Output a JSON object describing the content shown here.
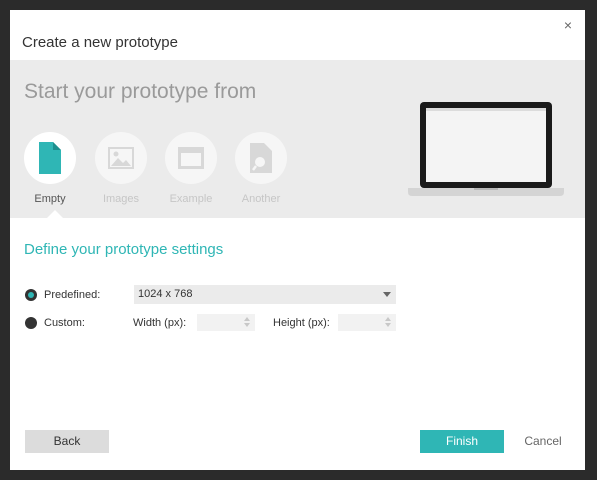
{
  "dialog": {
    "title": "Create a new prototype",
    "close_glyph": "×"
  },
  "start": {
    "heading": "Start your prototype from",
    "options": [
      {
        "label": "Empty",
        "icon": "document-icon",
        "active": true
      },
      {
        "label": "Images",
        "icon": "image-icon",
        "active": false
      },
      {
        "label": "Example",
        "icon": "window-icon",
        "active": false
      },
      {
        "label": "Another",
        "icon": "document-search-icon",
        "active": false
      }
    ]
  },
  "settings": {
    "heading": "Define your prototype settings",
    "predefined_label": "Predefined:",
    "predefined_value": "1024 x 768",
    "custom_label": "Custom:",
    "width_label": "Width (px):",
    "height_label": "Height (px):"
  },
  "buttons": {
    "back": "Back",
    "finish": "Finish",
    "cancel": "Cancel"
  },
  "colors": {
    "accent": "#2fb6b5",
    "band": "#ebebeb",
    "outer": "#2b2b2b"
  }
}
